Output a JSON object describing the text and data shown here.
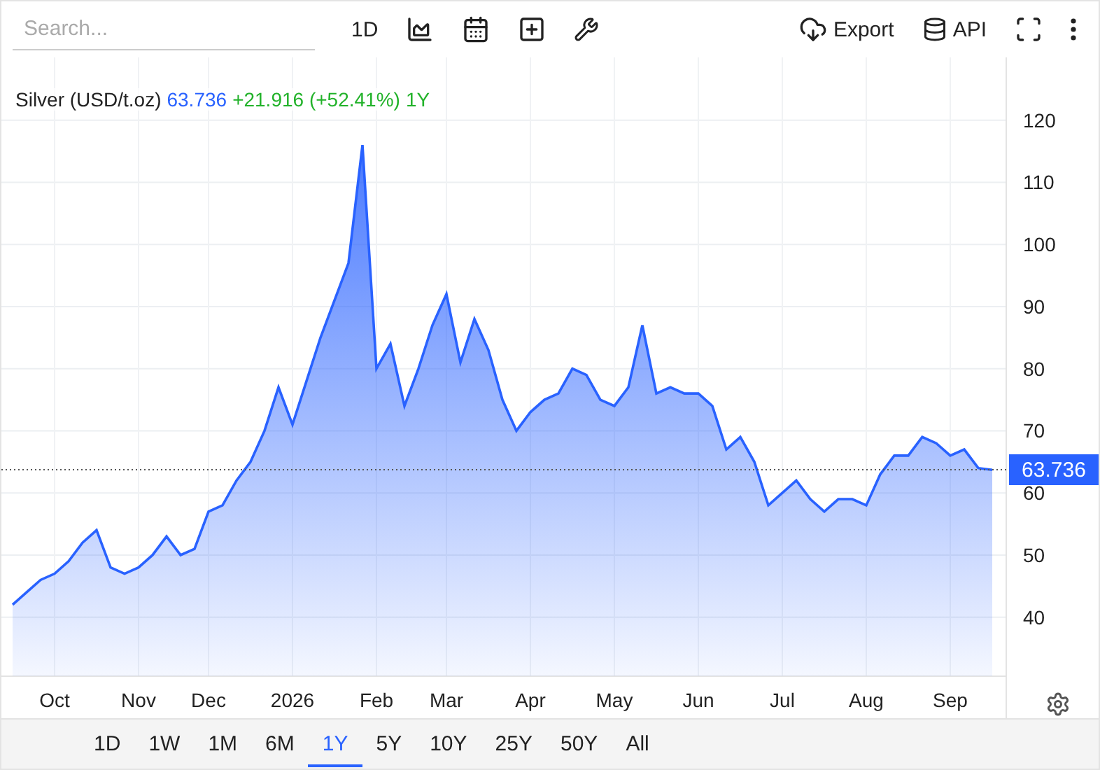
{
  "toolbar": {
    "search": {
      "placeholder": "Search..."
    },
    "interval": "1D",
    "export": "Export",
    "api": "API"
  },
  "chart": {
    "legend": {
      "price": "63.736",
      "change": "+21.916 (+52.41%)",
      "period": "1Y"
    },
    "chart_data": {
      "type": "area",
      "grid": true,
      "ref_lines": [
        {
          "axis": "y",
          "value": 63.736,
          "label": "63.736"
        }
      ],
      "ylim": [
        30.5,
        130.1
      ],
      "categories": [
        null,
        null,
        null,
        "Oct",
        null,
        null,
        null,
        null,
        null,
        "Nov",
        null,
        null,
        null,
        null,
        "Dec",
        null,
        null,
        null,
        null,
        null,
        "2026",
        null,
        null,
        null,
        null,
        null,
        "Feb",
        null,
        null,
        null,
        null,
        "Mar",
        null,
        null,
        null,
        null,
        null,
        "Apr",
        null,
        null,
        null,
        null,
        null,
        "May",
        null,
        null,
        null,
        null,
        null,
        "Jun",
        null,
        null,
        null,
        null,
        null,
        "Jul",
        null,
        null,
        null,
        null,
        null,
        "Aug",
        null,
        null,
        null,
        null,
        null,
        "Sep",
        null,
        null,
        null
      ],
      "yticks": [
        40,
        50,
        60,
        70,
        80,
        90,
        100,
        110,
        120
      ],
      "series": [
        {
          "name": "Silver (USD/t.oz)",
          "color": "#2962ff",
          "values": [
            42,
            44,
            46,
            47,
            49,
            52,
            54,
            48,
            47,
            48,
            50,
            53,
            50,
            51,
            57,
            58,
            62,
            65,
            70,
            77,
            71,
            78,
            85,
            91,
            97,
            116,
            80,
            84,
            74,
            80,
            87,
            92,
            81,
            88,
            83,
            75,
            70,
            73,
            75,
            76,
            80,
            79,
            75,
            74,
            77,
            87,
            76,
            77,
            76,
            76,
            74,
            67,
            69,
            65,
            58,
            60,
            62,
            59,
            57,
            59,
            59,
            58,
            63,
            66,
            66,
            69,
            68,
            66,
            67,
            64,
            63.7
          ]
        }
      ]
    }
  },
  "ranges": [
    {
      "label": "1D",
      "selected": false
    },
    {
      "label": "1W",
      "selected": false
    },
    {
      "label": "1M",
      "selected": false
    },
    {
      "label": "6M",
      "selected": false
    },
    {
      "label": "1Y",
      "selected": true
    },
    {
      "label": "5Y",
      "selected": false
    },
    {
      "label": "10Y",
      "selected": false
    },
    {
      "label": "25Y",
      "selected": false
    },
    {
      "label": "50Y",
      "selected": false
    },
    {
      "label": "All",
      "selected": false
    }
  ]
}
